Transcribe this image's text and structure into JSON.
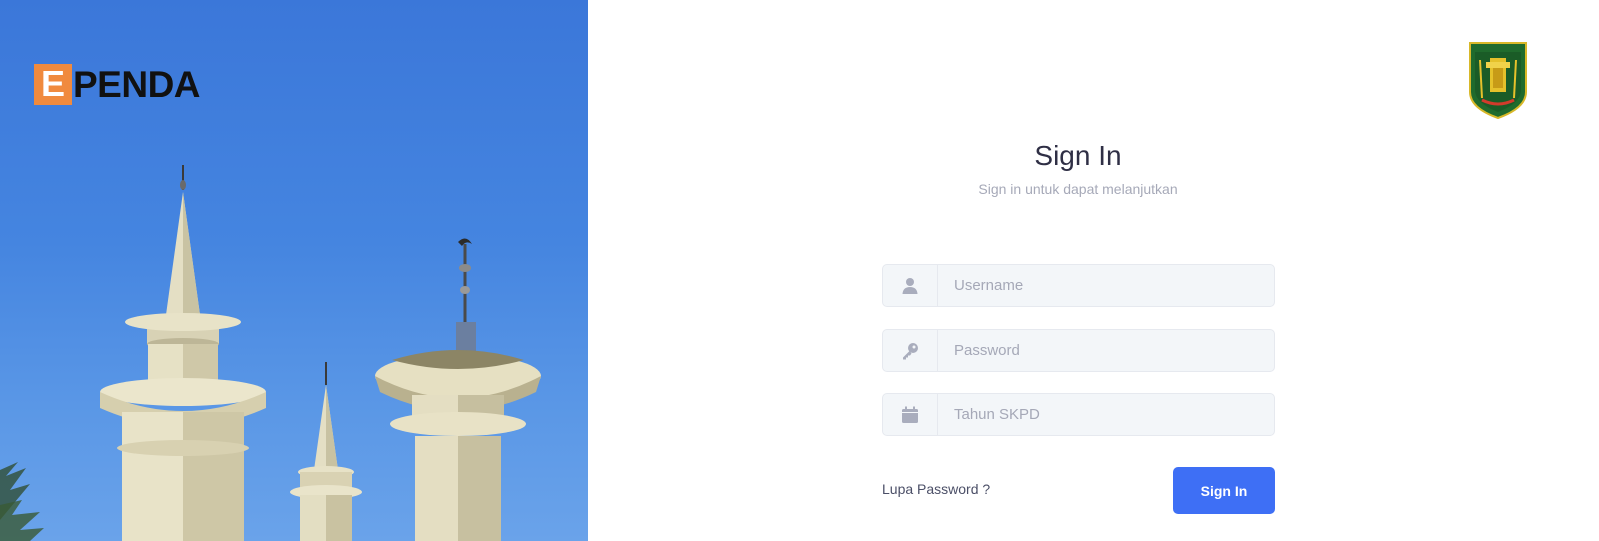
{
  "brand": {
    "letter": "E",
    "text": "PENDA",
    "accent_color": "#f08a3e"
  },
  "emblem": {
    "label": "TABALONG",
    "icon": "tabalong-regency-emblem"
  },
  "signin": {
    "title": "Sign In",
    "subtitle": "Sign in untuk dapat melanjutkan"
  },
  "form": {
    "username": {
      "placeholder": "Username",
      "value": "",
      "icon": "user-icon"
    },
    "password": {
      "placeholder": "Password",
      "value": "",
      "icon": "key-icon"
    },
    "year": {
      "placeholder": "Tahun SKPD",
      "value": "",
      "icon": "calendar-icon"
    }
  },
  "forgot_label": "Lupa Password ?",
  "submit_label": "Sign In",
  "colors": {
    "primary": "#3e6ff5",
    "field_bg": "#f3f6f9",
    "sky": "#4585e0"
  }
}
